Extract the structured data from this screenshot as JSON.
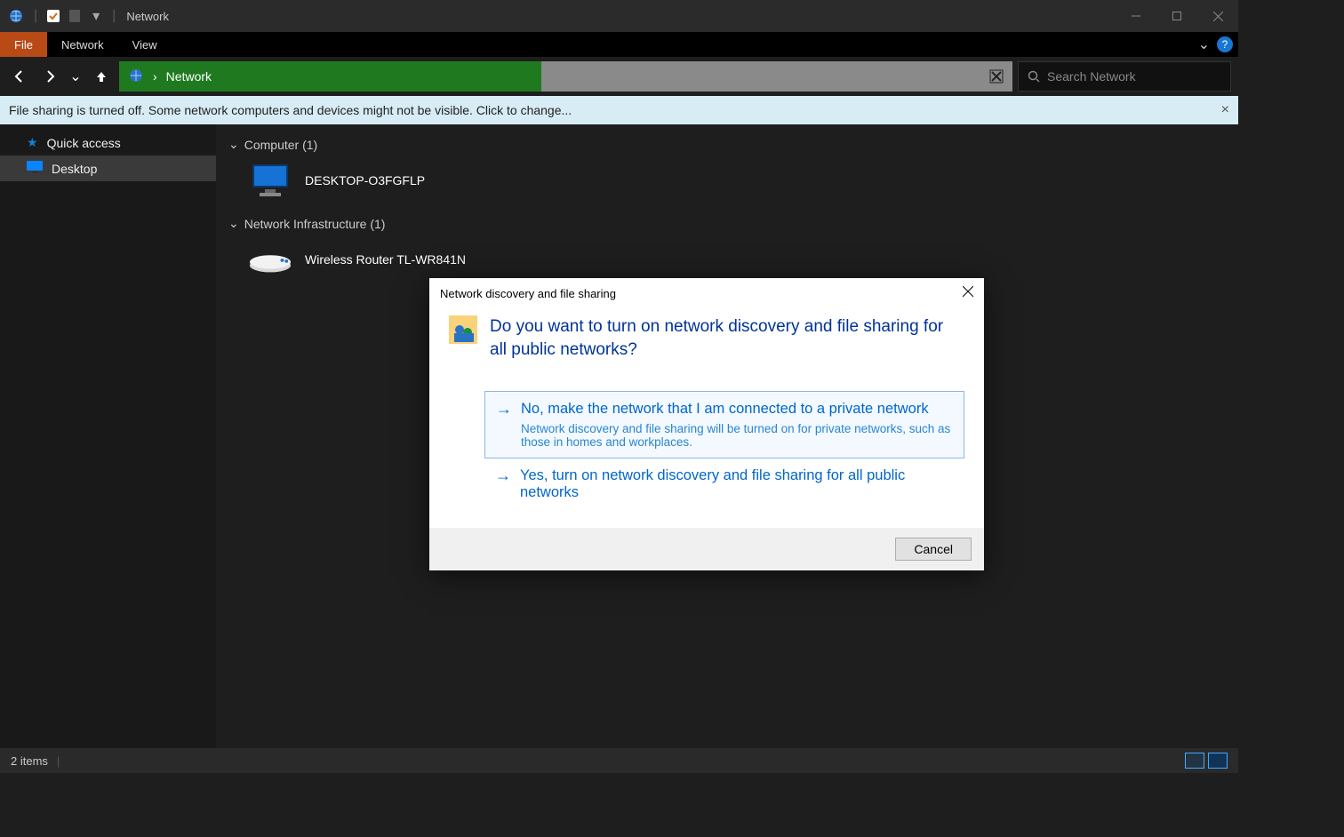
{
  "window": {
    "title": "Network"
  },
  "ribbon": {
    "tabs": [
      "File",
      "Network",
      "View"
    ]
  },
  "address": {
    "location": "Network",
    "chevron": "›"
  },
  "search": {
    "placeholder": "Search Network"
  },
  "infobar": {
    "text": "File sharing is turned off. Some network computers and devices might not be visible. Click to change..."
  },
  "sidebar": {
    "items": [
      {
        "label": "Quick access"
      },
      {
        "label": "Desktop"
      }
    ]
  },
  "content": {
    "groups": [
      {
        "header": "Computer (1)",
        "items": [
          {
            "label": "DESKTOP-O3FGFLP",
            "icon": "monitor"
          }
        ]
      },
      {
        "header": "Network Infrastructure (1)",
        "items": [
          {
            "label": "Wireless Router TL-WR841N",
            "icon": "router"
          }
        ]
      }
    ]
  },
  "statusbar": {
    "text": "2 items"
  },
  "dialog": {
    "title": "Network discovery and file sharing",
    "heading": "Do you want to turn on network discovery and file sharing for all public networks?",
    "options": [
      {
        "title": "No, make the network that I am connected to a private network",
        "sub": "Network discovery and file sharing will be turned on for private networks, such as those in homes and workplaces."
      },
      {
        "title": "Yes, turn on network discovery and file sharing for all public networks",
        "sub": ""
      }
    ],
    "cancel": "Cancel"
  }
}
